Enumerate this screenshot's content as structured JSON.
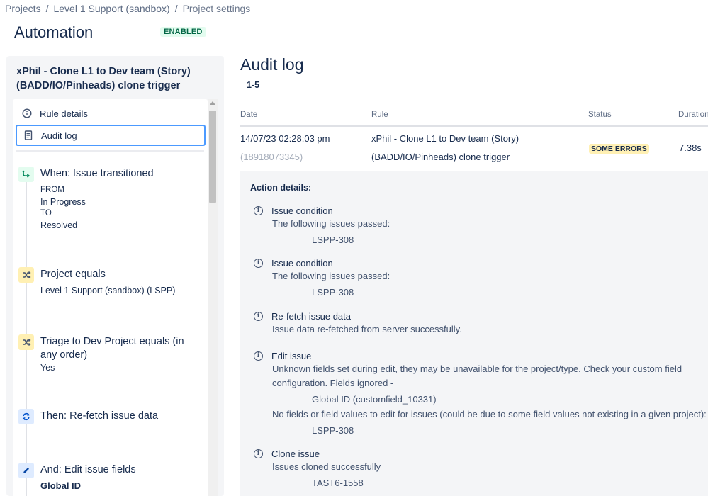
{
  "breadcrumb": {
    "items": [
      "Projects",
      "Level 1 Support (sandbox)",
      "Project settings"
    ],
    "separator": "/"
  },
  "page": {
    "title": "Automation",
    "status_badge": "ENABLED"
  },
  "rule": {
    "title": "xPhil - Clone L1 to Dev team (Story) (BADD/IO/Pinheads) clone trigger"
  },
  "nav": {
    "rule_details": "Rule details",
    "audit_log": "Audit log"
  },
  "steps": [
    {
      "icon": "transition-icon",
      "title": "When: Issue transitioned",
      "lines": [
        "FROM",
        "In Progress",
        "TO",
        "Resolved"
      ]
    },
    {
      "icon": "shuffle-icon",
      "title": "Project equals",
      "lines": [
        "Level 1 Support (sandbox) (LSPP)"
      ]
    },
    {
      "icon": "shuffle-icon",
      "title": "Triage to Dev Project equals (in any order)",
      "lines": [
        "Yes"
      ]
    },
    {
      "icon": "refresh-icon",
      "title": "Then: Re-fetch issue data",
      "lines": []
    },
    {
      "icon": "pencil-icon",
      "title": "And: Edit issue fields",
      "lines": [
        "Global ID"
      ]
    }
  ],
  "audit": {
    "title": "Audit log",
    "range": "1-5",
    "columns": {
      "date": "Date",
      "rule": "Rule",
      "status": "Status",
      "duration": "Duration"
    },
    "row": {
      "date": "14/07/23 02:28:03 pm",
      "id": "(18918073345)",
      "rule_line1": "xPhil - Clone L1 to Dev team (Story)",
      "rule_line2": "(BADD/IO/Pinheads) clone trigger",
      "status": "SOME ERRORS",
      "duration": "7.38s"
    }
  },
  "details": {
    "title": "Action details:",
    "actions": [
      {
        "name": "Issue condition",
        "message": "The following issues passed:",
        "value": "LSPP-308"
      },
      {
        "name": "Issue condition",
        "message": "The following issues passed:",
        "value": "LSPP-308"
      },
      {
        "name": "Re-fetch issue data",
        "message": "Issue data re-fetched from server successfully."
      },
      {
        "name": "Edit issue",
        "message": "Unknown fields set during edit, they may be unavailable for the project/type. Check your custom field configuration. Fields ignored -",
        "value": "Global ID (customfield_10331)",
        "message2": "No fields or field values to edit for issues (could be due to some field values not existing in a given project):",
        "value2": "LSPP-308"
      },
      {
        "name": "Clone issue",
        "message": "Issues cloned successfully",
        "value": "TAST6-1558"
      }
    ]
  },
  "colors": {
    "selected_border": "#4c9aff",
    "enabled_bg": "#e3fcef",
    "enabled_text": "#006644",
    "warning_bg": "#fff0b3",
    "panel_bg": "#f4f5f7"
  }
}
